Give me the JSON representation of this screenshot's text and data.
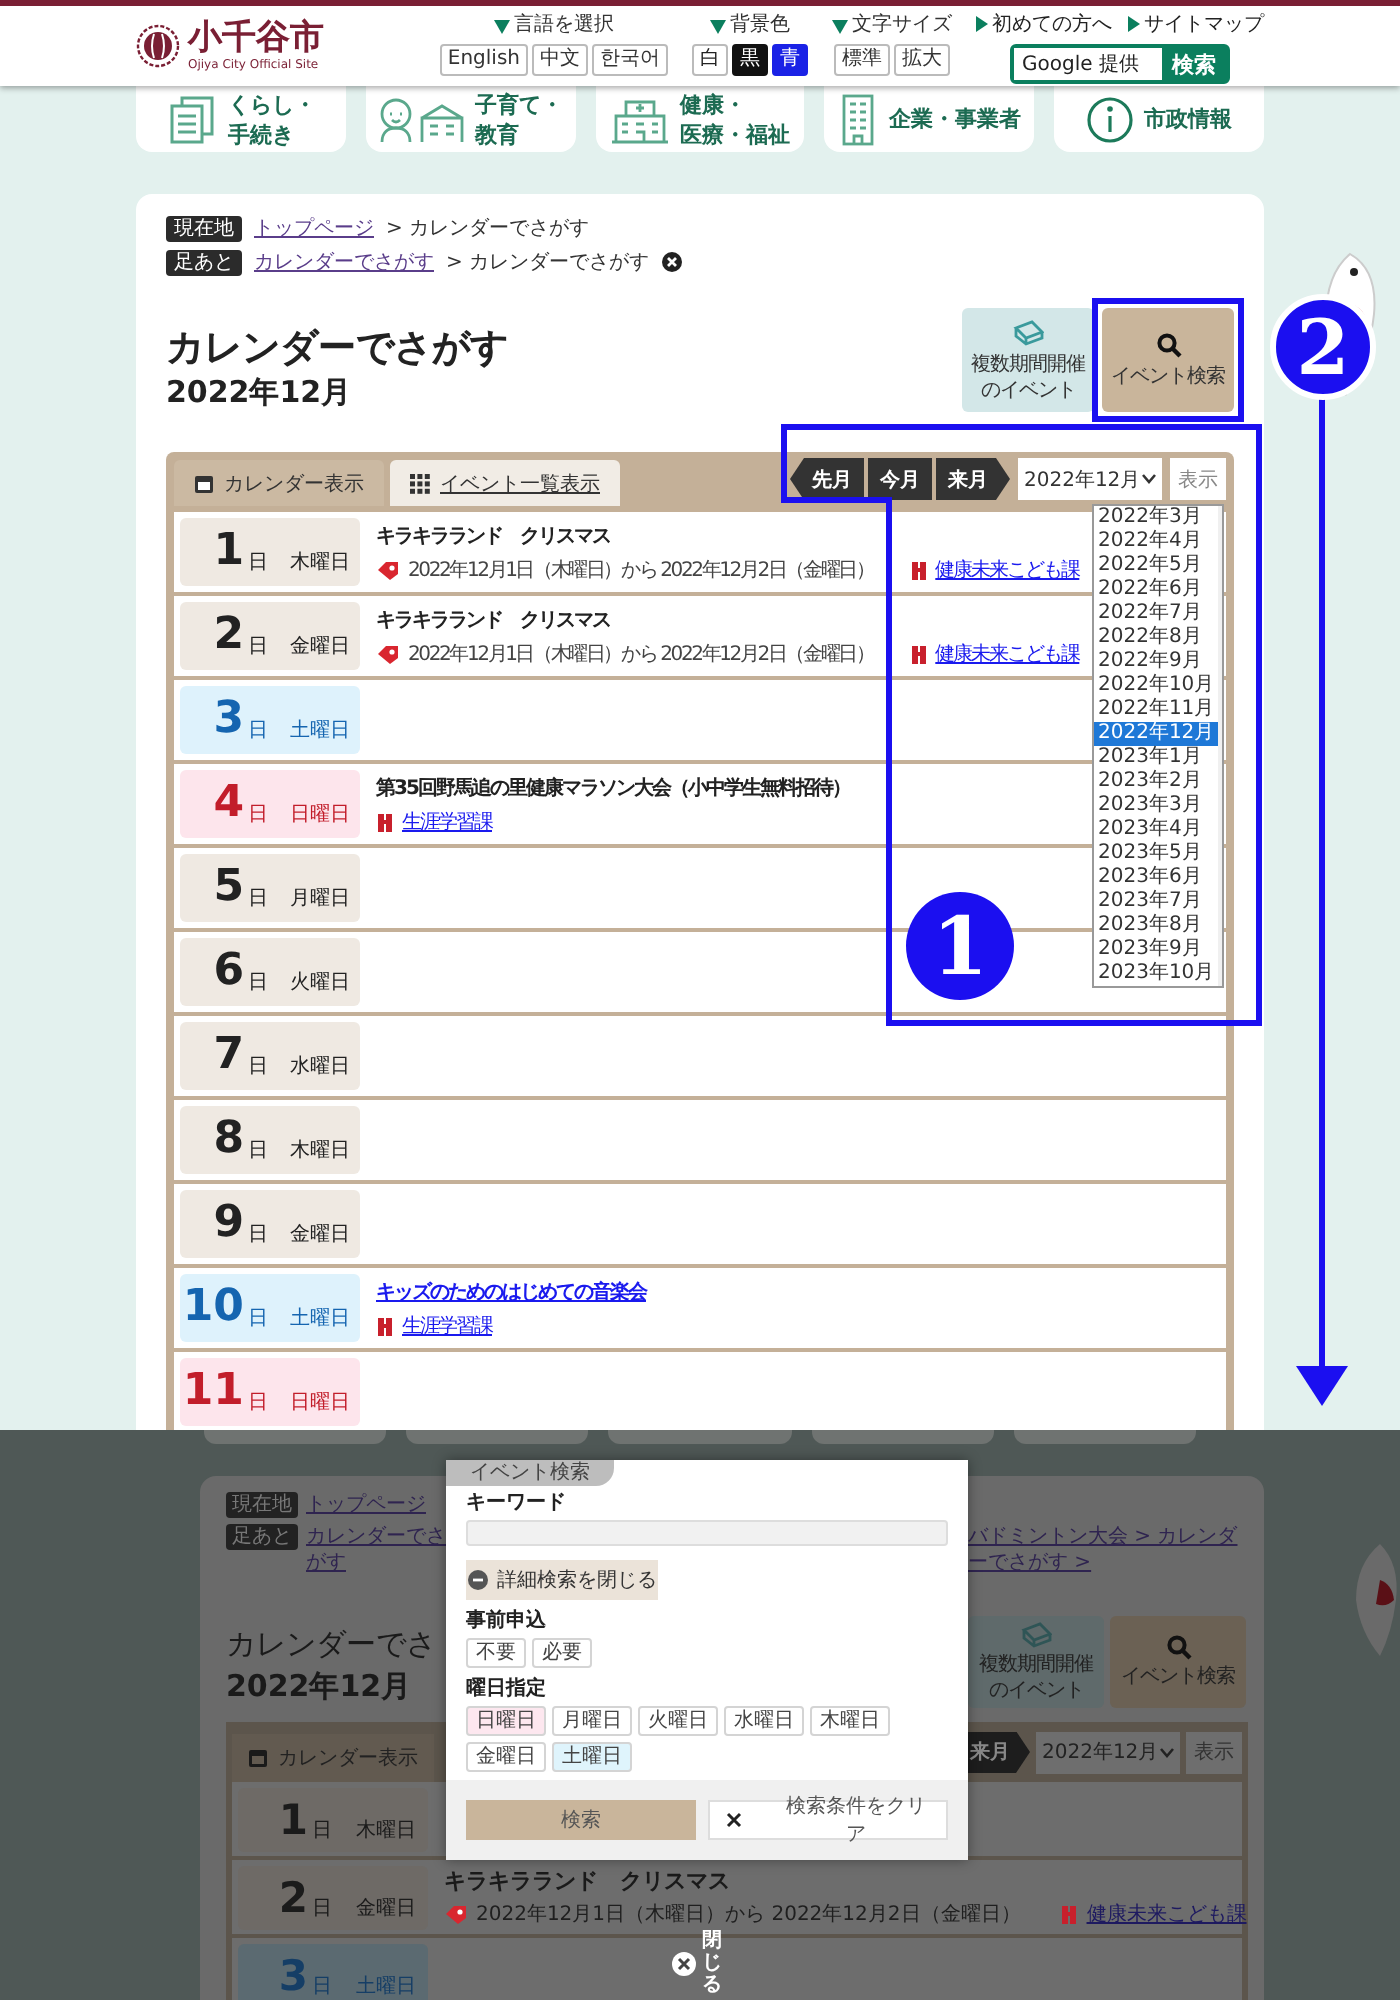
{
  "header": {
    "title": "小千谷市",
    "subtitle": "Ojiya City Official Site",
    "language": {
      "label": "言語を選択",
      "options": [
        "English",
        "中文",
        "한국어"
      ]
    },
    "background_color": {
      "label": "背景色",
      "options": [
        {
          "label": "白",
          "kind": "white"
        },
        {
          "label": "黒",
          "kind": "black"
        },
        {
          "label": "青",
          "kind": "blue"
        }
      ]
    },
    "font_size": {
      "label": "文字サイズ",
      "options": [
        "標準",
        "拡大"
      ]
    },
    "links": [
      "初めての方へ",
      "サイトマップ"
    ],
    "search": {
      "placeholder": "Google 提供",
      "button": "検索"
    }
  },
  "nav": [
    {
      "lines": [
        "くらし・",
        "手続き"
      ],
      "kind": "documents"
    },
    {
      "lines": [
        "子育て・",
        "教育"
      ],
      "kind": "children"
    },
    {
      "lines": [
        "健康・",
        "医療・福祉"
      ],
      "kind": "hospital"
    },
    {
      "lines": [
        "企業・事業者"
      ],
      "kind": "office"
    },
    {
      "lines": [
        "市政情報"
      ],
      "kind": "info"
    }
  ],
  "breadcrumbs": [
    {
      "label": "現在地",
      "kind": "location",
      "link": "トップページ",
      "current": "> カレンダーでさがす"
    },
    {
      "label": "足あと",
      "kind": "history",
      "link": "カレンダーでさがす",
      "current": "> カレンダーでさがす"
    }
  ],
  "title": "カレンダーでさがす",
  "month": "2022年12月",
  "action_buttons": [
    {
      "label": "複数期間開催のイベント",
      "kind": "multi_period"
    },
    {
      "label": "イベント検索",
      "kind": "search"
    }
  ],
  "calendar": {
    "tabs": [
      {
        "label": "カレンダー表示",
        "kind": "calendar",
        "selected": true
      },
      {
        "label": "イベント一覧表示",
        "kind": "list",
        "selected": false
      }
    ],
    "month_nav": [
      {
        "label": "先月",
        "kind": "prev"
      },
      {
        "label": "今月",
        "kind": "current"
      },
      {
        "label": "来月",
        "kind": "next"
      }
    ],
    "month_select": {
      "value": "2022年12月",
      "expanded": true,
      "options": [
        {
          "label": "2022年3月",
          "selected": false
        },
        {
          "label": "2022年4月",
          "selected": false
        },
        {
          "label": "2022年5月",
          "selected": false
        },
        {
          "label": "2022年6月",
          "selected": false
        },
        {
          "label": "2022年7月",
          "selected": false
        },
        {
          "label": "2022年8月",
          "selected": false
        },
        {
          "label": "2022年9月",
          "selected": false
        },
        {
          "label": "2022年10月",
          "selected": false
        },
        {
          "label": "2022年11月",
          "selected": false
        },
        {
          "label": "2022年12月",
          "selected": true
        },
        {
          "label": "2023年1月",
          "selected": false
        },
        {
          "label": "2023年2月",
          "selected": false
        },
        {
          "label": "2023年3月",
          "selected": false
        },
        {
          "label": "2023年4月",
          "selected": false
        },
        {
          "label": "2023年5月",
          "selected": false
        },
        {
          "label": "2023年6月",
          "selected": false
        },
        {
          "label": "2023年7月",
          "selected": false
        },
        {
          "label": "2023年8月",
          "selected": false
        },
        {
          "label": "2023年9月",
          "selected": false
        },
        {
          "label": "2023年10月",
          "selected": false
        }
      ]
    },
    "show_button": "表示",
    "days": [
      {
        "day": "1",
        "unit": "日",
        "weekday": "木曜日",
        "kind": "weekday",
        "events": [
          {
            "title": "キラキラランド　クリスマス",
            "is_link": false,
            "period": "2022年12月1日（木曜日）から 2022年12月2日（金曜日）",
            "department": "健康未来こども課"
          }
        ]
      },
      {
        "day": "2",
        "unit": "日",
        "weekday": "金曜日",
        "kind": "weekday",
        "events": [
          {
            "title": "キラキラランド　クリスマス",
            "is_link": false,
            "period": "2022年12月1日（木曜日）から 2022年12月2日（金曜日）",
            "department": "健康未来こども課"
          }
        ]
      },
      {
        "day": "3",
        "unit": "日",
        "weekday": "土曜日",
        "kind": "saturday"
      },
      {
        "day": "4",
        "unit": "日",
        "weekday": "日曜日",
        "kind": "sunday",
        "events": [
          {
            "title": "第35回野馬追の里健康マラソン大会（小中学生無料招待）",
            "is_link": false,
            "department": "生涯学習課"
          }
        ]
      },
      {
        "day": "5",
        "unit": "日",
        "weekday": "月曜日",
        "kind": "weekday"
      },
      {
        "day": "6",
        "unit": "日",
        "weekday": "火曜日",
        "kind": "weekday"
      },
      {
        "day": "7",
        "unit": "日",
        "weekday": "水曜日",
        "kind": "weekday"
      },
      {
        "day": "8",
        "unit": "日",
        "weekday": "木曜日",
        "kind": "weekday"
      },
      {
        "day": "9",
        "unit": "日",
        "weekday": "金曜日",
        "kind": "weekday"
      },
      {
        "day": "10",
        "unit": "日",
        "weekday": "土曜日",
        "kind": "saturday",
        "events": [
          {
            "title": "キッズのためのはじめての音楽会",
            "is_link": true,
            "department": "生涯学習課"
          }
        ]
      },
      {
        "day": "11",
        "unit": "日",
        "weekday": "日曜日",
        "kind": "sunday"
      }
    ]
  },
  "annotations": [
    {
      "number": "1"
    },
    {
      "number": "2"
    }
  ],
  "search_overlay": {
    "backdrop": {
      "breadcrumbs": [
        {
          "label": "現在地",
          "link": "トップページ"
        },
        {
          "label": "足あと",
          "link": "カレンダーでさがす",
          "trail": "バドミントン大会 > カレンダーでさがす >"
        }
      ],
      "title": "カレンダーでさ",
      "month": "2022年12月",
      "action_buttons": [
        {
          "label": "複数期間開催のイベント",
          "kind": "multi_period"
        },
        {
          "label": "イベント検索",
          "kind": "search"
        }
      ],
      "tab": "カレンダー表示",
      "next_month": "来月",
      "month_select": "2022年12月",
      "show_button": "表示",
      "days": [
        {
          "day": "1",
          "unit": "日",
          "weekday": "木曜日",
          "kind": "weekday"
        },
        {
          "day": "2",
          "unit": "日",
          "weekday": "金曜日",
          "kind": "weekday",
          "event": {
            "title": "キラキラランド　クリスマス",
            "period": "2022年12月1日（木曜日）から 2022年12月2日（金曜日）",
            "department": "健康未来こども課"
          }
        },
        {
          "day": "3",
          "unit": "日",
          "weekday": "土曜日",
          "kind": "saturday"
        }
      ]
    },
    "modal": {
      "tab": "イベント検索",
      "keyword_label": "キーワード",
      "detail_toggle": "詳細検索を閉じる",
      "application": {
        "label": "事前申込",
        "options": [
          {
            "label": "不要",
            "selected": false
          },
          {
            "label": "必要",
            "selected": false
          }
        ]
      },
      "weekdays": {
        "label": "曜日指定",
        "options": [
          {
            "label": "日曜日",
            "kind": "sunday",
            "selected": false
          },
          {
            "label": "月曜日",
            "kind": "weekday",
            "selected": false
          },
          {
            "label": "火曜日",
            "kind": "weekday",
            "selected": false
          },
          {
            "label": "水曜日",
            "kind": "weekday",
            "selected": false
          },
          {
            "label": "木曜日",
            "kind": "weekday",
            "selected": false
          },
          {
            "label": "金曜日",
            "kind": "weekday",
            "selected": false
          },
          {
            "label": "土曜日",
            "kind": "saturday",
            "selected": false
          }
        ]
      },
      "search_button": "検索",
      "clear_button": "検索条件をクリア"
    },
    "close": "閉じる"
  }
}
